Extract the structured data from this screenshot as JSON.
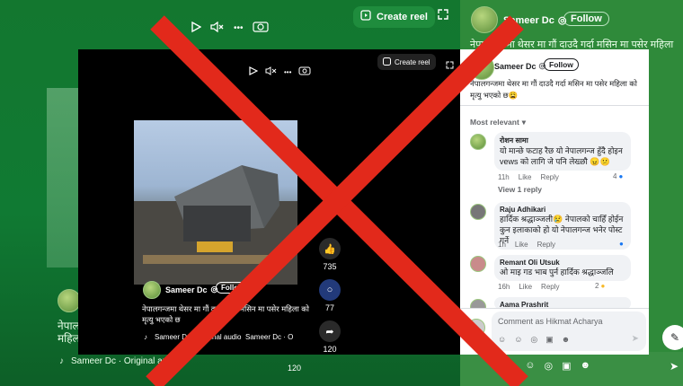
{
  "background": {
    "toolbar_create_reel": "Create reel",
    "header_author": "Sameer Dc",
    "header_follow": "Follow",
    "header_caption": "नेपालगन्जमा थेसर मा गौं दाउदै गर्दा मसिन मा पसेर महिला",
    "left_caption_line1": "नेपाल",
    "left_caption_line2": "महिल",
    "left_footer_audio": "Sameer Dc · Original audio",
    "left_footer_author": "Sameer Dc · O",
    "left_share_count": "120"
  },
  "popup": {
    "create_reel": "Create reel",
    "video": {
      "author": "Sameer Dc",
      "follow": "Follow",
      "caption": "नेपालगन्जमा थेसर मा गौं दाउदै गर्दा मसिन मा पसेर महिला को मृत्यु भएको छ",
      "audio_left": "Sameer Dc · Original audio",
      "audio_right": "Sameer Dc · O",
      "like_count": "735",
      "comment_count": "77",
      "share_count": "120"
    },
    "post": {
      "author": "Sameer Dc",
      "follow": "Follow",
      "caption": "नेपालगन्जमा थेसर मा गौं दाउदै  गर्दा मसिन मा पसेर महिला को मृत्यु भएको छ😩",
      "sort_label": "Most relevant"
    },
    "comments": [
      {
        "name": "रोशन सामा",
        "text": "यो मान्छे फटाह रैछ यो नेपालगन्ज हुँदै होइन vews को लागि जे पनि लेख्छौ 😠😕",
        "time": "11h",
        "like": "Like",
        "reply": "Reply",
        "reactions": "4",
        "view_replies": "View 1 reply"
      },
      {
        "name": "Raju Adhikari",
        "text": "हार्दिक श्रद्धाञ्जली😢 नेपालको चाहिँ होईन कुन इलाकाको हो यो नेपालगन्ज भनेर पोस्ट गर्ने",
        "time": "1h",
        "like": "Like",
        "reply": "Reply",
        "reactions": ""
      },
      {
        "name": "Remant Oli Utsuk",
        "text": "ओ माइ गड भाब पुर्न हार्दिक श्रद्धाञ्जलि",
        "time": "16h",
        "like": "Like",
        "reply": "Reply",
        "reactions": "2"
      },
      {
        "name": "Aama Prashrit",
        "text": "",
        "time": "",
        "like": "",
        "reply": "",
        "reactions": ""
      }
    ],
    "comment_placeholder": "Comment as Hikmat Acharya"
  },
  "colors": {
    "overlay_x": "#e2291b",
    "bg_green": "#107a33",
    "fb_blue": "#1877f2"
  }
}
